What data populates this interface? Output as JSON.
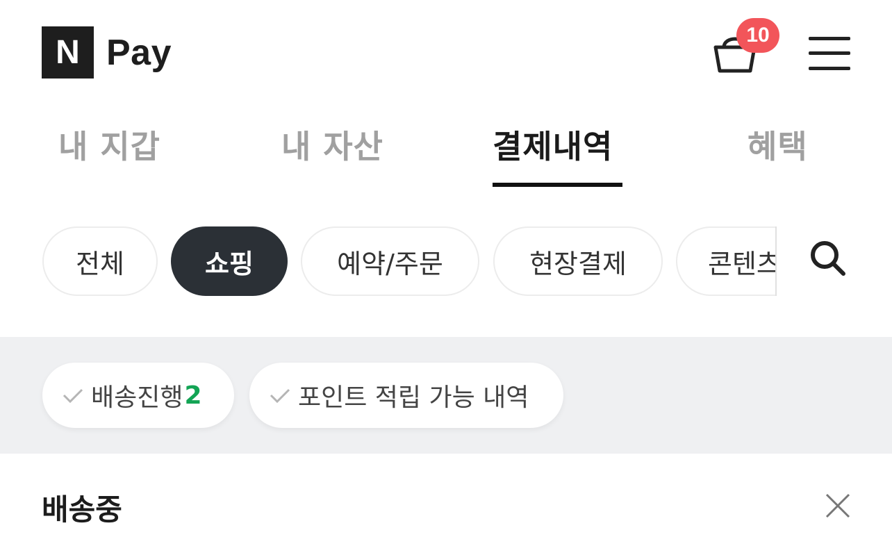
{
  "header": {
    "logo_mark": "N",
    "logo_text": "Pay",
    "cart_icon": "shopping-basket-icon",
    "cart_badge": "10",
    "menu_icon": "hamburger-menu-icon"
  },
  "main_tabs": [
    {
      "label": "내 지갑",
      "active": false
    },
    {
      "label": "내 자산",
      "active": false
    },
    {
      "label": "결제내역",
      "active": true
    },
    {
      "label": "혜택",
      "active": false
    }
  ],
  "filter_chips": [
    {
      "label": "전체",
      "selected": false
    },
    {
      "label": "쇼핑",
      "selected": true
    },
    {
      "label": "예약/주문",
      "selected": false
    },
    {
      "label": "현장결제",
      "selected": false
    },
    {
      "label": "콘텐츠",
      "selected": false
    }
  ],
  "search_icon": "search-icon",
  "quick_filters": [
    {
      "label": "배송진행",
      "count": "2"
    },
    {
      "label": "포인트 적립 가능 내역"
    }
  ],
  "section": {
    "title": "배송중",
    "close_icon": "close-icon"
  },
  "colors": {
    "badge": "#f2555a",
    "selected_chip": "#2b3036",
    "count_green": "#13a455",
    "band_bg": "#eff0f2"
  }
}
